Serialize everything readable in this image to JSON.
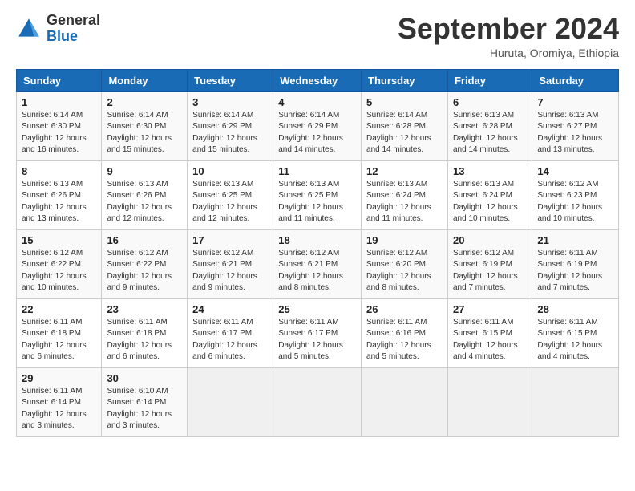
{
  "header": {
    "logo_general": "General",
    "logo_blue": "Blue",
    "month_title": "September 2024",
    "subtitle": "Huruta, Oromiya, Ethiopia"
  },
  "weekdays": [
    "Sunday",
    "Monday",
    "Tuesday",
    "Wednesday",
    "Thursday",
    "Friday",
    "Saturday"
  ],
  "weeks": [
    [
      {
        "day": "1",
        "info": "Sunrise: 6:14 AM\nSunset: 6:30 PM\nDaylight: 12 hours\nand 16 minutes."
      },
      {
        "day": "2",
        "info": "Sunrise: 6:14 AM\nSunset: 6:30 PM\nDaylight: 12 hours\nand 15 minutes."
      },
      {
        "day": "3",
        "info": "Sunrise: 6:14 AM\nSunset: 6:29 PM\nDaylight: 12 hours\nand 15 minutes."
      },
      {
        "day": "4",
        "info": "Sunrise: 6:14 AM\nSunset: 6:29 PM\nDaylight: 12 hours\nand 14 minutes."
      },
      {
        "day": "5",
        "info": "Sunrise: 6:14 AM\nSunset: 6:28 PM\nDaylight: 12 hours\nand 14 minutes."
      },
      {
        "day": "6",
        "info": "Sunrise: 6:13 AM\nSunset: 6:28 PM\nDaylight: 12 hours\nand 14 minutes."
      },
      {
        "day": "7",
        "info": "Sunrise: 6:13 AM\nSunset: 6:27 PM\nDaylight: 12 hours\nand 13 minutes."
      }
    ],
    [
      {
        "day": "8",
        "info": "Sunrise: 6:13 AM\nSunset: 6:26 PM\nDaylight: 12 hours\nand 13 minutes."
      },
      {
        "day": "9",
        "info": "Sunrise: 6:13 AM\nSunset: 6:26 PM\nDaylight: 12 hours\nand 12 minutes."
      },
      {
        "day": "10",
        "info": "Sunrise: 6:13 AM\nSunset: 6:25 PM\nDaylight: 12 hours\nand 12 minutes."
      },
      {
        "day": "11",
        "info": "Sunrise: 6:13 AM\nSunset: 6:25 PM\nDaylight: 12 hours\nand 11 minutes."
      },
      {
        "day": "12",
        "info": "Sunrise: 6:13 AM\nSunset: 6:24 PM\nDaylight: 12 hours\nand 11 minutes."
      },
      {
        "day": "13",
        "info": "Sunrise: 6:13 AM\nSunset: 6:24 PM\nDaylight: 12 hours\nand 10 minutes."
      },
      {
        "day": "14",
        "info": "Sunrise: 6:12 AM\nSunset: 6:23 PM\nDaylight: 12 hours\nand 10 minutes."
      }
    ],
    [
      {
        "day": "15",
        "info": "Sunrise: 6:12 AM\nSunset: 6:22 PM\nDaylight: 12 hours\nand 10 minutes."
      },
      {
        "day": "16",
        "info": "Sunrise: 6:12 AM\nSunset: 6:22 PM\nDaylight: 12 hours\nand 9 minutes."
      },
      {
        "day": "17",
        "info": "Sunrise: 6:12 AM\nSunset: 6:21 PM\nDaylight: 12 hours\nand 9 minutes."
      },
      {
        "day": "18",
        "info": "Sunrise: 6:12 AM\nSunset: 6:21 PM\nDaylight: 12 hours\nand 8 minutes."
      },
      {
        "day": "19",
        "info": "Sunrise: 6:12 AM\nSunset: 6:20 PM\nDaylight: 12 hours\nand 8 minutes."
      },
      {
        "day": "20",
        "info": "Sunrise: 6:12 AM\nSunset: 6:19 PM\nDaylight: 12 hours\nand 7 minutes."
      },
      {
        "day": "21",
        "info": "Sunrise: 6:11 AM\nSunset: 6:19 PM\nDaylight: 12 hours\nand 7 minutes."
      }
    ],
    [
      {
        "day": "22",
        "info": "Sunrise: 6:11 AM\nSunset: 6:18 PM\nDaylight: 12 hours\nand 6 minutes."
      },
      {
        "day": "23",
        "info": "Sunrise: 6:11 AM\nSunset: 6:18 PM\nDaylight: 12 hours\nand 6 minutes."
      },
      {
        "day": "24",
        "info": "Sunrise: 6:11 AM\nSunset: 6:17 PM\nDaylight: 12 hours\nand 6 minutes."
      },
      {
        "day": "25",
        "info": "Sunrise: 6:11 AM\nSunset: 6:17 PM\nDaylight: 12 hours\nand 5 minutes."
      },
      {
        "day": "26",
        "info": "Sunrise: 6:11 AM\nSunset: 6:16 PM\nDaylight: 12 hours\nand 5 minutes."
      },
      {
        "day": "27",
        "info": "Sunrise: 6:11 AM\nSunset: 6:15 PM\nDaylight: 12 hours\nand 4 minutes."
      },
      {
        "day": "28",
        "info": "Sunrise: 6:11 AM\nSunset: 6:15 PM\nDaylight: 12 hours\nand 4 minutes."
      }
    ],
    [
      {
        "day": "29",
        "info": "Sunrise: 6:11 AM\nSunset: 6:14 PM\nDaylight: 12 hours\nand 3 minutes."
      },
      {
        "day": "30",
        "info": "Sunrise: 6:10 AM\nSunset: 6:14 PM\nDaylight: 12 hours\nand 3 minutes."
      },
      {
        "day": "",
        "info": ""
      },
      {
        "day": "",
        "info": ""
      },
      {
        "day": "",
        "info": ""
      },
      {
        "day": "",
        "info": ""
      },
      {
        "day": "",
        "info": ""
      }
    ]
  ]
}
